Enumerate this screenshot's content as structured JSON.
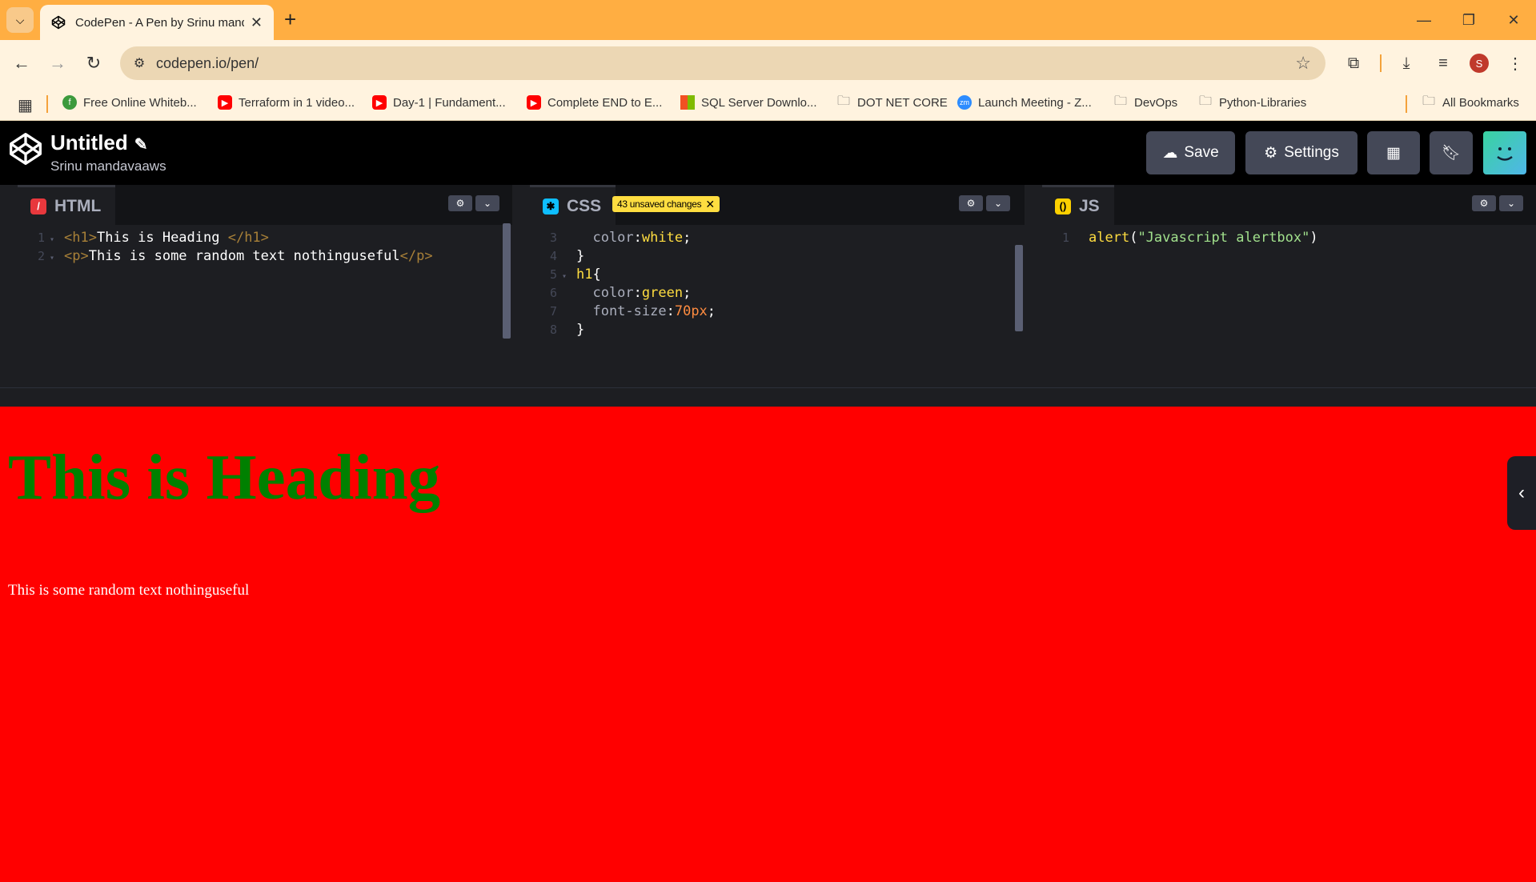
{
  "browser": {
    "tab_title": "CodePen - A Pen by Srinu mandavaaws",
    "url": "codepen.io/pen/",
    "profile_initial": "S",
    "accent_color": "#ffae42"
  },
  "bookmarks": [
    {
      "label": "Free Online Whiteb...",
      "icon": "green-f-icon"
    },
    {
      "label": "Terraform in 1 video...",
      "icon": "youtube-icon"
    },
    {
      "label": "Day-1 | Fundament...",
      "icon": "youtube-icon"
    },
    {
      "label": "Complete END to E...",
      "icon": "youtube-icon"
    },
    {
      "label": "SQL Server Downlo...",
      "icon": "microsoft-icon"
    },
    {
      "label": "DOT NET CORE",
      "icon": "folder-icon"
    },
    {
      "label": "Launch Meeting - Z...",
      "icon": "zoom-icon"
    },
    {
      "label": "DevOps",
      "icon": "folder-icon"
    },
    {
      "label": "Python-Libraries",
      "icon": "folder-icon"
    }
  ],
  "all_bookmarks": "All Bookmarks",
  "codepen": {
    "title": "Untitled",
    "user": "Srinu mandavaaws",
    "save_label": "Save",
    "settings_label": "Settings"
  },
  "editors": {
    "html": {
      "label": "HTML",
      "lines": [
        {
          "n": "1",
          "tokens": [
            [
              "t-tag",
              "<h1>"
            ],
            [
              "",
              "This is Heading "
            ],
            [
              "t-tag",
              "</h1>"
            ]
          ]
        },
        {
          "n": "2",
          "tokens": [
            [
              "t-tag",
              "<p>"
            ],
            [
              "",
              "This is some random text nothinguseful"
            ],
            [
              "t-tag",
              "</p>"
            ]
          ]
        }
      ]
    },
    "css": {
      "label": "CSS",
      "unsaved_badge": "43 unsaved changes",
      "lines": [
        {
          "n": "3",
          "tokens": [
            [
              "t-prop",
              "  color"
            ],
            [
              "",
              ":"
            ],
            [
              "t-val",
              "white"
            ],
            [
              "",
              ";"
            ]
          ]
        },
        {
          "n": "4",
          "tokens": [
            [
              "",
              "}"
            ]
          ]
        },
        {
          "n": "5",
          "tokens": [
            [
              "t-sel",
              "h1"
            ],
            [
              "",
              "{"
            ]
          ]
        },
        {
          "n": "6",
          "tokens": [
            [
              "t-prop",
              "  color"
            ],
            [
              "",
              ":"
            ],
            [
              "t-val",
              "green"
            ],
            [
              "",
              ";"
            ]
          ]
        },
        {
          "n": "7",
          "tokens": [
            [
              "t-prop",
              "  font-size"
            ],
            [
              "",
              ":"
            ],
            [
              "t-num",
              "70px"
            ],
            [
              "",
              ";"
            ]
          ]
        },
        {
          "n": "8",
          "tokens": [
            [
              "",
              "}"
            ]
          ]
        }
      ]
    },
    "js": {
      "label": "JS",
      "lines": [
        {
          "n": "1",
          "tokens": [
            [
              "t-fn",
              "alert"
            ],
            [
              "",
              "("
            ],
            [
              "t-str",
              "\"Javascript alertbox\""
            ],
            [
              "",
              ")"
            ]
          ]
        }
      ]
    }
  },
  "preview": {
    "heading": "This is Heading",
    "paragraph": "This is some random text nothinguseful",
    "background": "#ff0000",
    "heading_color": "#008000"
  }
}
